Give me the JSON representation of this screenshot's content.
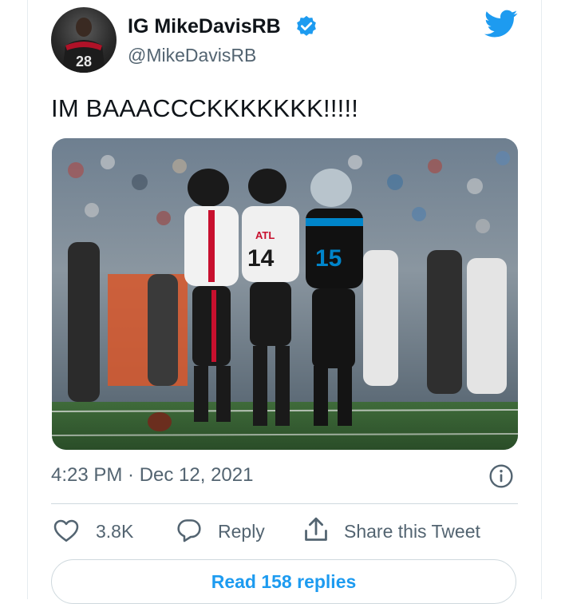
{
  "author": {
    "display_name": "IG MikeDavisRB",
    "handle": "@MikeDavisRB",
    "avatar_jersey_number": "28"
  },
  "tweet": {
    "text": "IM BAAACCCKKKKKKK!!!!!",
    "timestamp": "4:23 PM · Dec 12, 2021"
  },
  "media": {
    "jersey_numbers": [
      "14",
      "15"
    ],
    "helmet_logo_text": "ATL"
  },
  "actions": {
    "like_count": "3.8K",
    "reply_label": "Reply",
    "share_label": "Share this Tweet",
    "read_replies_label": "Read 158 replies"
  },
  "colors": {
    "twitter_blue": "#1d9bf0",
    "text_primary": "#0f1419",
    "text_secondary": "#536471",
    "falcons_red": "#c8102e",
    "panthers_blue": "#0085ca"
  },
  "icons": {
    "verified": "verified-badge-icon",
    "brand": "twitter-bird-icon",
    "info": "info-icon",
    "like": "heart-icon",
    "reply": "reply-bubble-icon",
    "share": "share-upload-icon"
  }
}
